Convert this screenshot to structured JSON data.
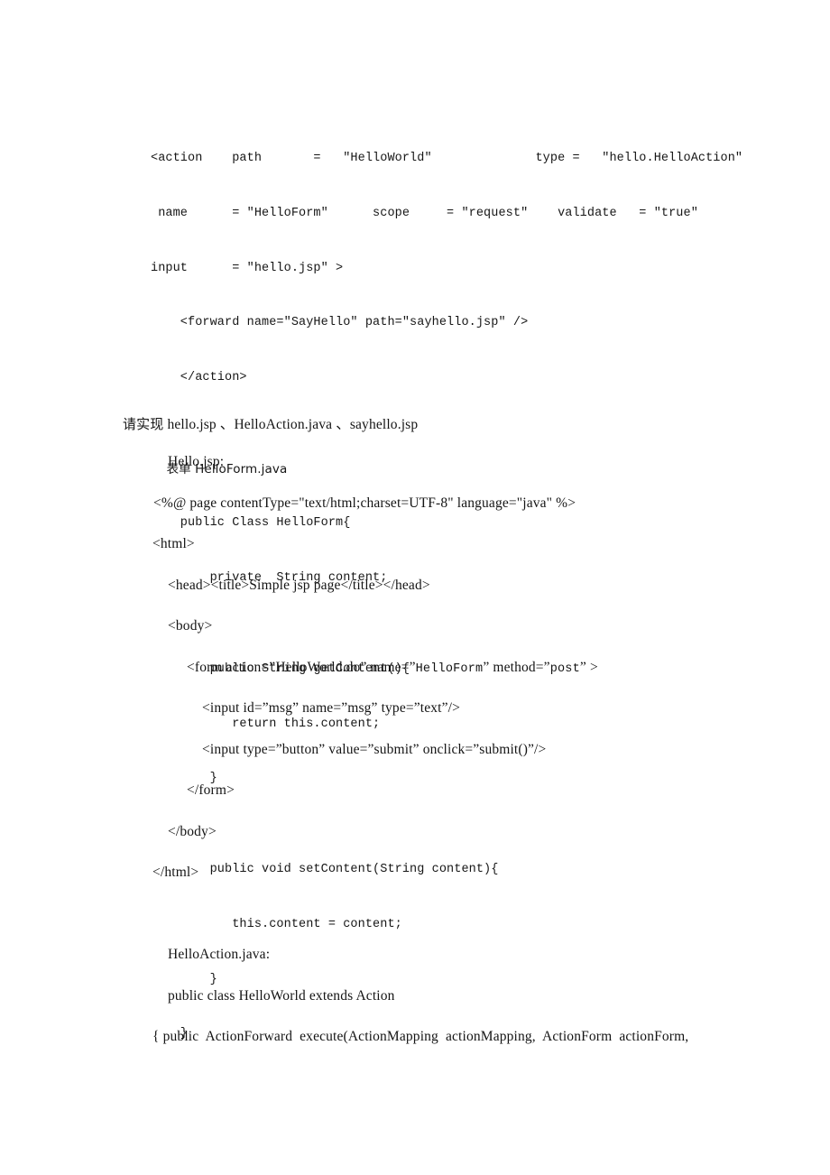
{
  "document": {
    "page_background": "#ffffff",
    "text_color": "#141414",
    "code_block": {
      "name": "struts-action-and-helloform-code",
      "lines": [
        "<action    path       =   ″HelloWorld″              type =   ″hello.HelloAction″",
        " name      = ″HelloForm″      scope     = ″request″    validate   = ″true″",
        "input      = ″hello.jsp″ >",
        "    <forward name=″SayHello″ path=″sayhello.jsp″ />",
        "    </action>",
        "",
        "    表单 HelloForm.java",
        "    public Class HelloForm{",
        "        private  String content;",
        "",
        "        public String getContent(){",
        "           return this.content;",
        "        }",
        "",
        "        public void setContent(String content){",
        "           this.content = content;",
        "        }",
        "    }"
      ]
    },
    "instruction_line": {
      "cjk_prefix": "请实现",
      "text": " hello.jsp 、HelloAction.java 、sayhello.jsp"
    },
    "hello_jsp": {
      "heading": "Hello.jsp:",
      "lines": [
        "<%@ page contentType=\"text/html;charset=UTF-8\" language=\"java\" %>",
        "<html>",
        "<head><title>Simple jsp page</title></head>",
        "<body>",
        "</form>",
        "</body>",
        "</html>"
      ],
      "form_open_prefix": "<form action=”HelloWorld.do” name=”",
      "form_open_mono_1": "HelloForm",
      "form_open_mid": "” method=”",
      "form_open_mono_2": "post",
      "form_open_suffix": "” >",
      "input_text": "<input id=”msg” name=”msg” type=”text”/>",
      "input_button": "<input type=”button” value=”submit” onclick=”submit()”/>"
    },
    "hello_action": {
      "heading": "HelloAction.java:",
      "line_1": "public class HelloWorld extends Action",
      "line_2": "{ public  ActionForward  execute(ActionMapping  actionMapping,  ActionForm  actionForm,"
    }
  }
}
